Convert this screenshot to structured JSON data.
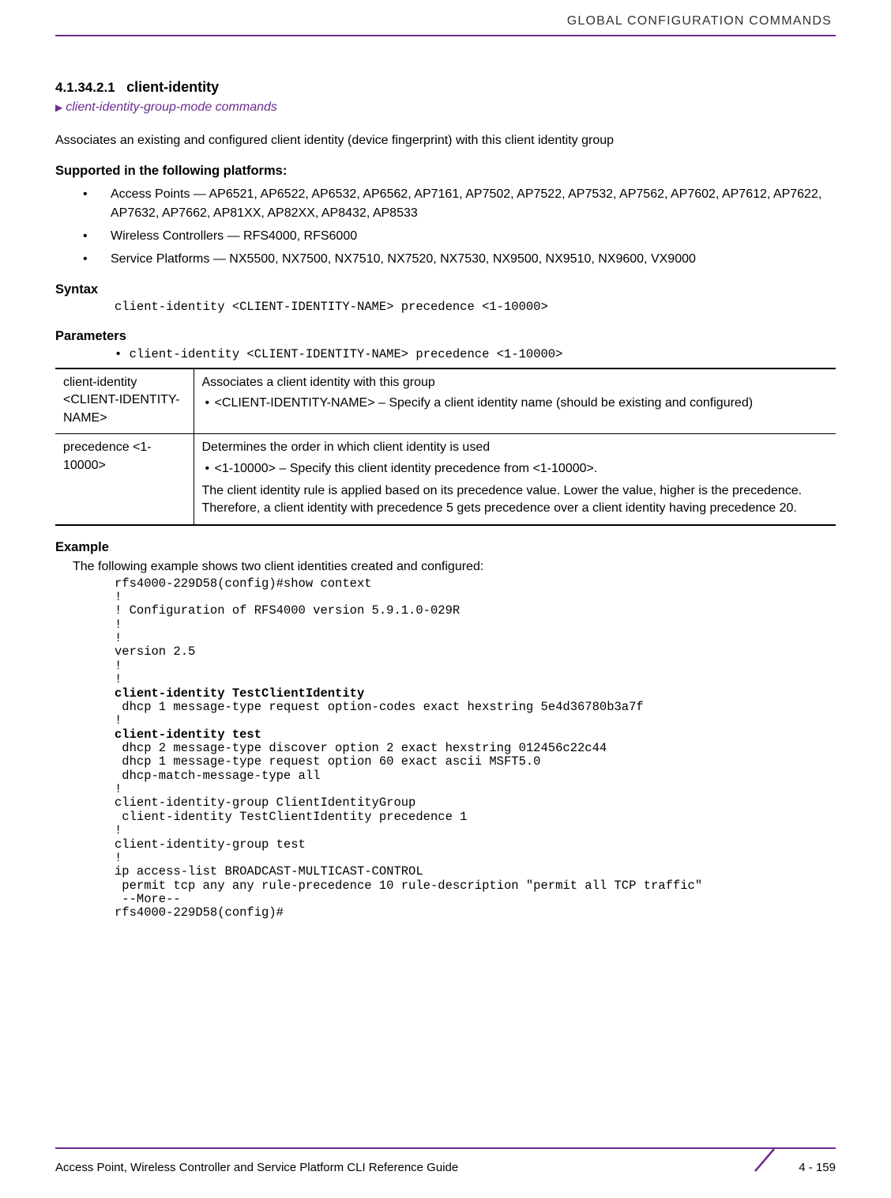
{
  "header": {
    "running_title": "GLOBAL CONFIGURATION COMMANDS"
  },
  "section": {
    "number": "4.1.34.2.1",
    "title": "client-identity",
    "breadcrumb": "client-identity-group-mode commands",
    "description": "Associates an existing and configured client identity (device fingerprint) with this client identity group"
  },
  "supported": {
    "heading": "Supported in the following platforms:",
    "items": [
      "Access Points — AP6521, AP6522, AP6532, AP6562, AP7161, AP7502, AP7522, AP7532, AP7562, AP7602, AP7612, AP7622, AP7632, AP7662, AP81XX, AP82XX, AP8432, AP8533",
      "Wireless Controllers — RFS4000, RFS6000",
      "Service Platforms — NX5500, NX7500, NX7510, NX7520, NX7530, NX9500, NX9510, NX9600, VX9000"
    ]
  },
  "syntax": {
    "heading": "Syntax",
    "code": "client-identity <CLIENT-IDENTITY-NAME> precedence <1-10000>"
  },
  "parameters": {
    "heading": "Parameters",
    "bullet": "client-identity <CLIENT-IDENTITY-NAME> precedence <1-10000>",
    "rows": [
      {
        "name": "client-identity <CLIENT-IDENTITY-NAME>",
        "main": "Associates a client identity with this group",
        "sub": "<CLIENT-IDENTITY-NAME> – Specify a client identity name (should be existing and configured)",
        "note": ""
      },
      {
        "name": "precedence <1-10000>",
        "main": "Determines the order in which client identity is used",
        "sub": "<1-10000> – Specify this client identity precedence from <1-10000>.",
        "note": "The client identity rule is applied based on its precedence value. Lower the value, higher is the precedence. Therefore, a client identity with precedence 5 gets precedence over a client identity having precedence 20."
      }
    ]
  },
  "example": {
    "heading": "Example",
    "intro": "The following example shows two client identities created and configured:",
    "lines": [
      {
        "t": "rfs4000-229D58(config)#show context",
        "b": false
      },
      {
        "t": "!",
        "b": false
      },
      {
        "t": "! Configuration of RFS4000 version 5.9.1.0-029R",
        "b": false
      },
      {
        "t": "!",
        "b": false
      },
      {
        "t": "!",
        "b": false
      },
      {
        "t": "version 2.5",
        "b": false
      },
      {
        "t": "!",
        "b": false
      },
      {
        "t": "!",
        "b": false
      },
      {
        "t": "client-identity TestClientIdentity",
        "b": true
      },
      {
        "t": " dhcp 1 message-type request option-codes exact hexstring 5e4d36780b3a7f",
        "b": false
      },
      {
        "t": "!",
        "b": false
      },
      {
        "t": "client-identity test",
        "b": true
      },
      {
        "t": " dhcp 2 message-type discover option 2 exact hexstring 012456c22c44",
        "b": false
      },
      {
        "t": " dhcp 1 message-type request option 60 exact ascii MSFT5.0",
        "b": false
      },
      {
        "t": " dhcp-match-message-type all",
        "b": false
      },
      {
        "t": "!",
        "b": false
      },
      {
        "t": "client-identity-group ClientIdentityGroup",
        "b": false
      },
      {
        "t": " client-identity TestClientIdentity precedence 1",
        "b": false
      },
      {
        "t": "!",
        "b": false
      },
      {
        "t": "client-identity-group test",
        "b": false
      },
      {
        "t": "!",
        "b": false
      },
      {
        "t": "ip access-list BROADCAST-MULTICAST-CONTROL",
        "b": false
      },
      {
        "t": " permit tcp any any rule-precedence 10 rule-description \"permit all TCP traffic\"",
        "b": false
      },
      {
        "t": " --More--",
        "b": false
      },
      {
        "t": "rfs4000-229D58(config)#",
        "b": false
      }
    ]
  },
  "footer": {
    "left": "Access Point, Wireless Controller and Service Platform CLI Reference Guide",
    "right": "4 - 159"
  }
}
